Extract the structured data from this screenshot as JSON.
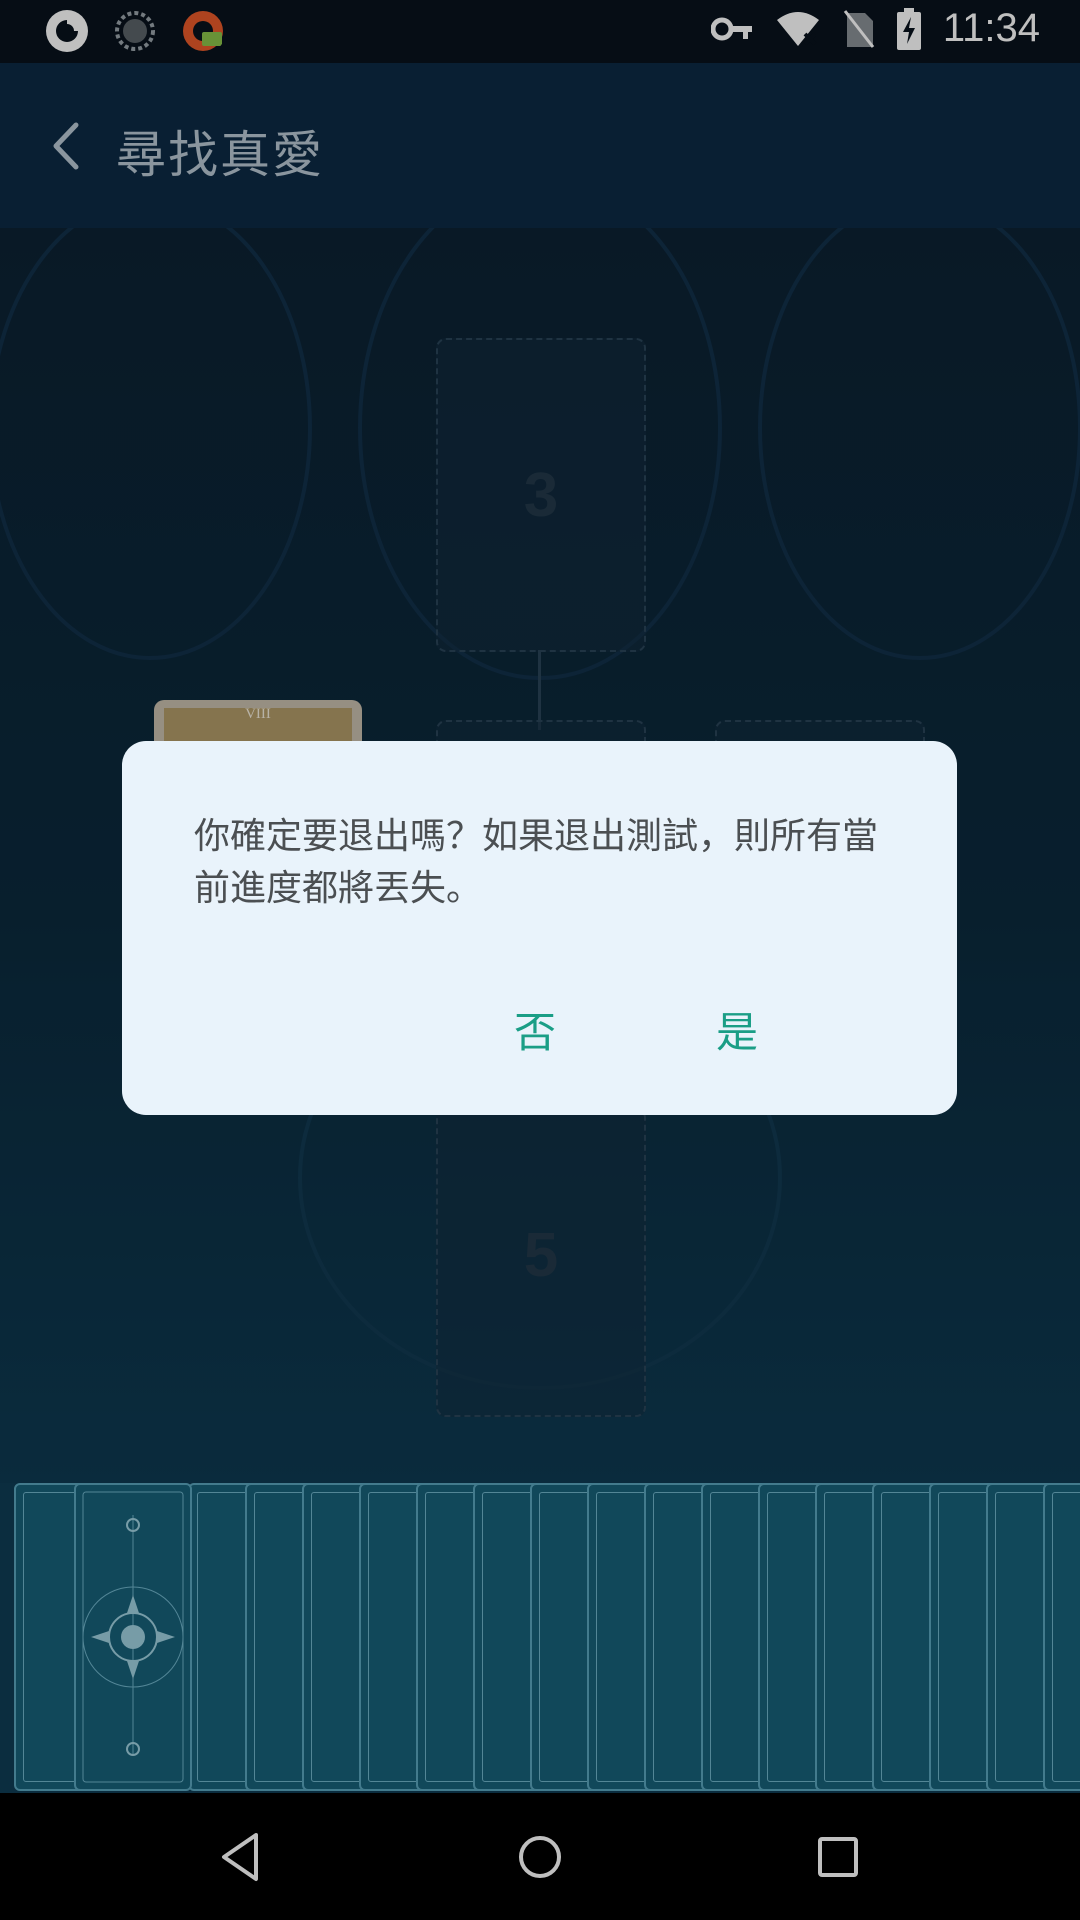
{
  "status_bar": {
    "time": "11:34",
    "icons": [
      "app-notification-icon",
      "loading-notification-icon",
      "vpn-app-notification-icon",
      "vpn-key-icon",
      "wifi-icon",
      "no-sim-icon",
      "battery-charging-icon"
    ]
  },
  "app_bar": {
    "title": "尋找真愛"
  },
  "spread": {
    "slot_numbers": [
      "3",
      "5"
    ],
    "placed_card_label": "VIII"
  },
  "dialog": {
    "message": "你確定要退出嗎？如果退出測試，則所有當前進度都將丟失。",
    "no_label": "否",
    "yes_label": "是"
  },
  "colors": {
    "accent": "#1a9e86",
    "app_bar": "#0c2a45",
    "dialog_bg": "#e9f3fb"
  }
}
